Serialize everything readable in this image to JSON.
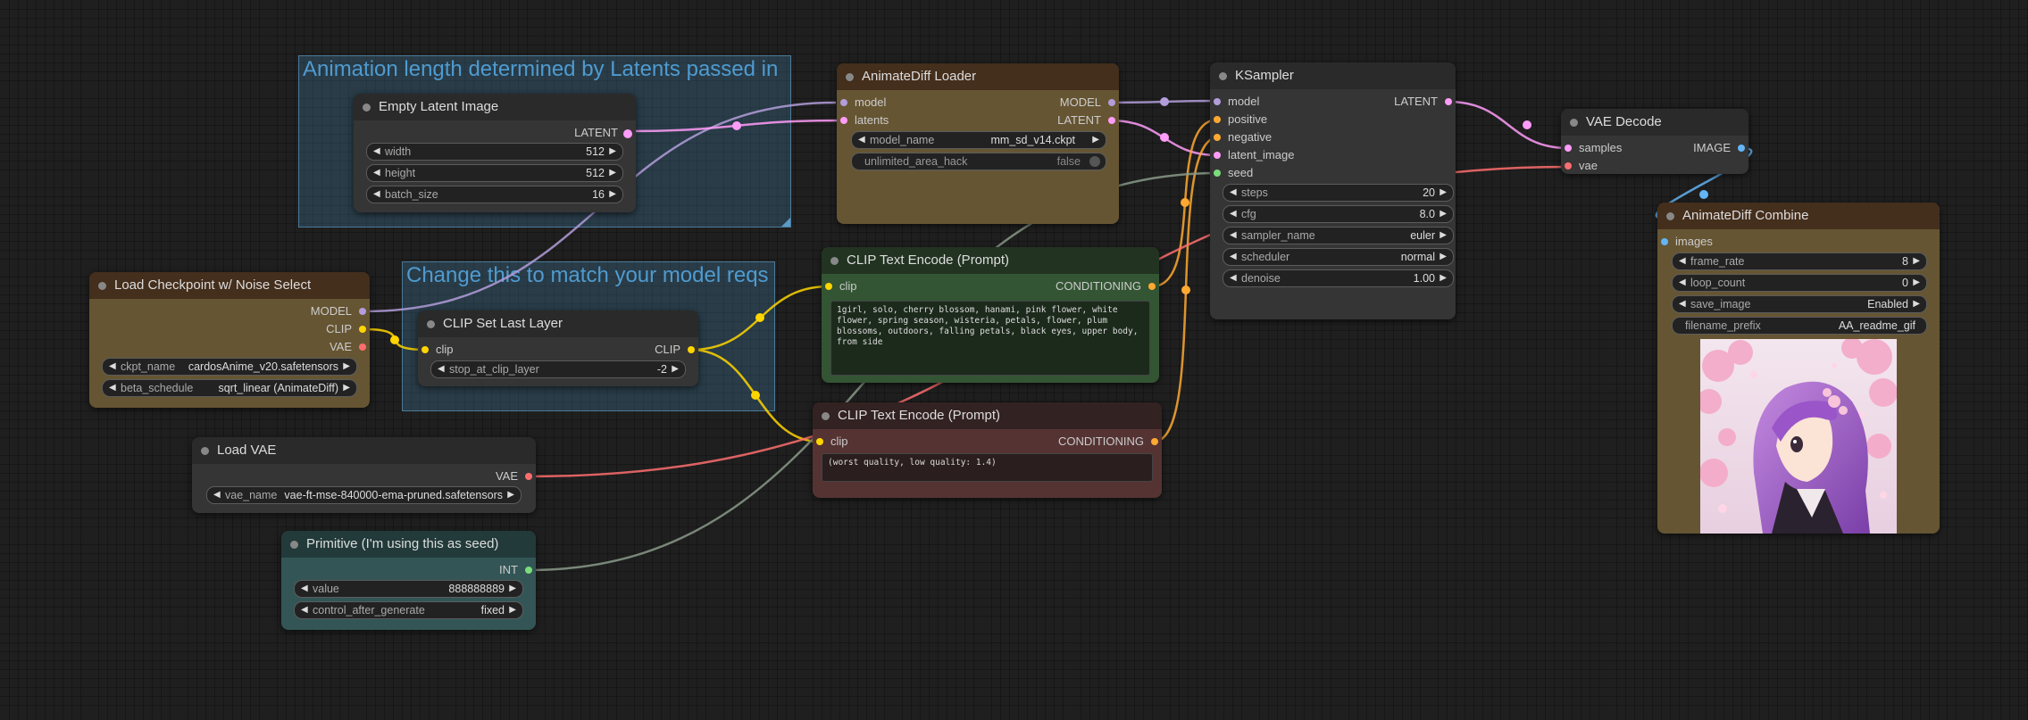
{
  "groups": [
    {
      "id": "g1",
      "title": "Animation length determined by Latents passed in"
    },
    {
      "id": "g2",
      "title": "Change this to match your model reqs"
    }
  ],
  "nodes": {
    "empty_latent": {
      "title": "Empty Latent Image",
      "outputs": [
        "LATENT"
      ],
      "widgets": [
        {
          "label": "width",
          "value": "512"
        },
        {
          "label": "height",
          "value": "512"
        },
        {
          "label": "batch_size",
          "value": "16"
        }
      ]
    },
    "load_checkpoint": {
      "title": "Load Checkpoint w/ Noise Select",
      "outputs": [
        "MODEL",
        "CLIP",
        "VAE"
      ],
      "widgets": [
        {
          "label": "ckpt_name",
          "value": "cardosAnime_v20.safetensors"
        },
        {
          "label": "beta_schedule",
          "value": "sqrt_linear (AnimateDiff)"
        }
      ]
    },
    "clip_set_last": {
      "title": "CLIP Set Last Layer",
      "inputs": [
        "clip"
      ],
      "outputs": [
        "CLIP"
      ],
      "widgets": [
        {
          "label": "stop_at_clip_layer",
          "value": "-2"
        }
      ]
    },
    "load_vae": {
      "title": "Load VAE",
      "outputs": [
        "VAE"
      ],
      "widgets": [
        {
          "label": "vae_name",
          "value": "vae-ft-mse-840000-ema-pruned.safetensors"
        }
      ]
    },
    "primitive": {
      "title": "Primitive (I'm using this as seed)",
      "outputs": [
        "INT"
      ],
      "widgets": [
        {
          "label": "value",
          "value": "888888889"
        },
        {
          "label": "control_after_generate",
          "value": "fixed"
        }
      ]
    },
    "animatediff_loader": {
      "title": "AnimateDiff Loader",
      "inputs": [
        "model",
        "latents"
      ],
      "outputs": [
        "MODEL",
        "LATENT"
      ],
      "widgets": [
        {
          "label": "model_name",
          "value": "mm_sd_v14.ckpt"
        },
        {
          "label": "unlimited_area_hack",
          "value": "false"
        }
      ]
    },
    "clip_pos": {
      "title": "CLIP Text Encode (Prompt)",
      "inputs": [
        "clip"
      ],
      "outputs": [
        "CONDITIONING"
      ],
      "text": "1girl, solo, cherry blossom, hanami, pink flower, white flower, spring season, wisteria, petals, flower, plum blossoms, outdoors, falling petals, black eyes, upper body, from side"
    },
    "clip_neg": {
      "title": "CLIP Text Encode (Prompt)",
      "inputs": [
        "clip"
      ],
      "outputs": [
        "CONDITIONING"
      ],
      "text": "(worst quality, low quality: 1.4)"
    },
    "ksampler": {
      "title": "KSampler",
      "inputs": [
        "model",
        "positive",
        "negative",
        "latent_image",
        "seed"
      ],
      "outputs": [
        "LATENT"
      ],
      "widgets": [
        {
          "label": "steps",
          "value": "20"
        },
        {
          "label": "cfg",
          "value": "8.0"
        },
        {
          "label": "sampler_name",
          "value": "euler"
        },
        {
          "label": "scheduler",
          "value": "normal"
        },
        {
          "label": "denoise",
          "value": "1.00"
        }
      ]
    },
    "vae_decode": {
      "title": "VAE Decode",
      "inputs": [
        "samples",
        "vae"
      ],
      "outputs": [
        "IMAGE"
      ]
    },
    "animatediff_combine": {
      "title": "AnimateDiff Combine",
      "inputs": [
        "images"
      ],
      "widgets": [
        {
          "label": "frame_rate",
          "value": "8"
        },
        {
          "label": "loop_count",
          "value": "0"
        },
        {
          "label": "save_image",
          "value": "Enabled"
        },
        {
          "label": "filename_prefix",
          "value": "AA_readme_gif"
        }
      ]
    }
  },
  "colors": {
    "model": "#b39ddb",
    "latent": "#ff9cf9",
    "clip": "#ffd500",
    "vae": "#ff6e6e",
    "conditioning": "#ffa931",
    "image": "#64b5f6",
    "int": "#7cdc7c",
    "seed_wire": "#8a9a8a"
  },
  "icons": {
    "arrow_left": "◀",
    "arrow_right": "▶"
  }
}
